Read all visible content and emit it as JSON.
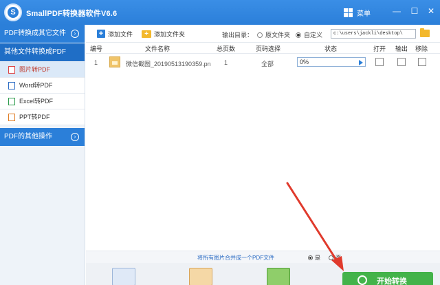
{
  "app": {
    "title": "SmallPDF转换器软件V6.6",
    "menu_label": "菜单"
  },
  "sidebar": {
    "sections": [
      {
        "label": "PDF转换成其它文件"
      },
      {
        "label": "其他文件转换成PDF"
      },
      {
        "label": "PDF的其他操作"
      }
    ],
    "items": [
      {
        "label": "图片转PDF",
        "selected": true
      },
      {
        "label": "Word转PDF"
      },
      {
        "label": "Excel转PDF"
      },
      {
        "label": "PPT转PDF"
      }
    ]
  },
  "toolbar": {
    "add_file": "添加文件",
    "add_folder": "添加文件夹",
    "output_label": "输出目录：",
    "radio_original": "原文件夹",
    "radio_custom": "自定义",
    "output_path": "c:\\users\\jackli\\desktop\\"
  },
  "table": {
    "headers": [
      "编号",
      "文件名称",
      "总页数",
      "页码选择",
      "状态",
      "打开",
      "输出",
      "移除"
    ],
    "rows": [
      {
        "index": "1",
        "name": "微信截图_20190513190359.pn",
        "pages": "1",
        "page_select": "全部",
        "progress": "0%"
      }
    ]
  },
  "merge": {
    "text": "将所有图片合并成一个PDF文件",
    "yes": "是",
    "no": "否",
    "selected": "yes"
  },
  "start_button": "开始转换",
  "colors": {
    "accent": "#2b7fd9",
    "start": "#43b34a",
    "arrow": "#e03a2c"
  }
}
